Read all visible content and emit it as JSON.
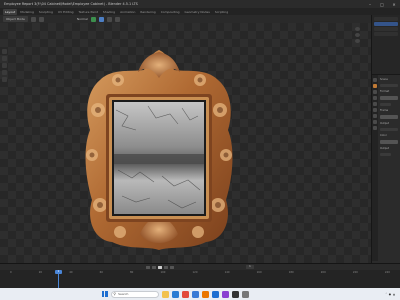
{
  "window": {
    "title": "Employee Report 3(F:\\04 Cabinet\\Model\\Employee Cabinet) - Blender 4.5.1 LTS",
    "controls": [
      "minimize-icon",
      "maximize-icon",
      "close-icon"
    ]
  },
  "workspace_tabs": [
    {
      "label": "Layout",
      "active": true
    },
    {
      "label": "Modeling",
      "active": false
    },
    {
      "label": "Sculpting",
      "active": false
    },
    {
      "label": "UV Editing",
      "active": false
    },
    {
      "label": "Texture Paint",
      "active": false
    },
    {
      "label": "Shading",
      "active": false
    },
    {
      "label": "Animation",
      "active": false
    },
    {
      "label": "Rendering",
      "active": false
    },
    {
      "label": "Compositing",
      "active": false
    },
    {
      "label": "Geometry Nodes",
      "active": false
    },
    {
      "label": "Scripting",
      "active": false
    }
  ],
  "viewport_header": {
    "mode": "Object Mode",
    "orientation": "Normal"
  },
  "properties_panel": {
    "texts": [
      "Scene",
      "Format",
      "Frame",
      "Output",
      "Color",
      "Output"
    ]
  },
  "timeline": {
    "current_frame": "1",
    "ruler_ticks": [
      "0",
      "20",
      "40",
      "60",
      "80",
      "100",
      "120",
      "140",
      "160",
      "180",
      "200",
      "220",
      "240"
    ]
  },
  "taskbar": {
    "search_placeholder": "Search",
    "apps": [
      "file-explorer-icon",
      "edge-icon",
      "chrome-icon",
      "store-icon",
      "blender-icon",
      "mail-icon",
      "photos-icon",
      "terminal-icon",
      "settings-icon"
    ],
    "app_colors": [
      "#f2c14e",
      "#2b7cd3",
      "#e24a3b",
      "#3a7bd5",
      "#ea7600",
      "#1f6fd1",
      "#8a3fd1",
      "#333333",
      "#777777"
    ]
  }
}
